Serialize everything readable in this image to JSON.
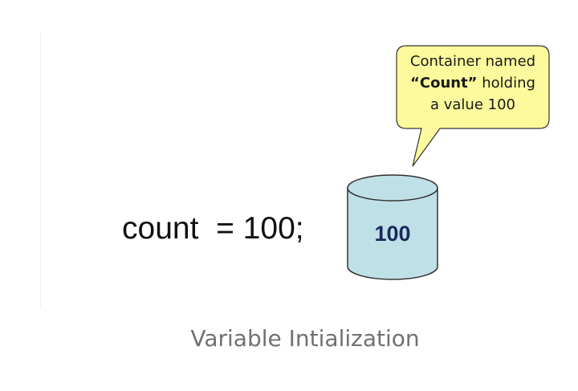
{
  "code_statement": "count  = 100;",
  "callout": {
    "line1": "Container named",
    "bold_word": "“Count”",
    "line2_rest": " holding",
    "line3": "a value 100"
  },
  "cylinder": {
    "value": "100",
    "fill_color": "#bfe0e6",
    "stroke_color": "#333333"
  },
  "callout_style": {
    "fill_color": "#fcfa9c"
  },
  "caption": "Variable Intialization"
}
